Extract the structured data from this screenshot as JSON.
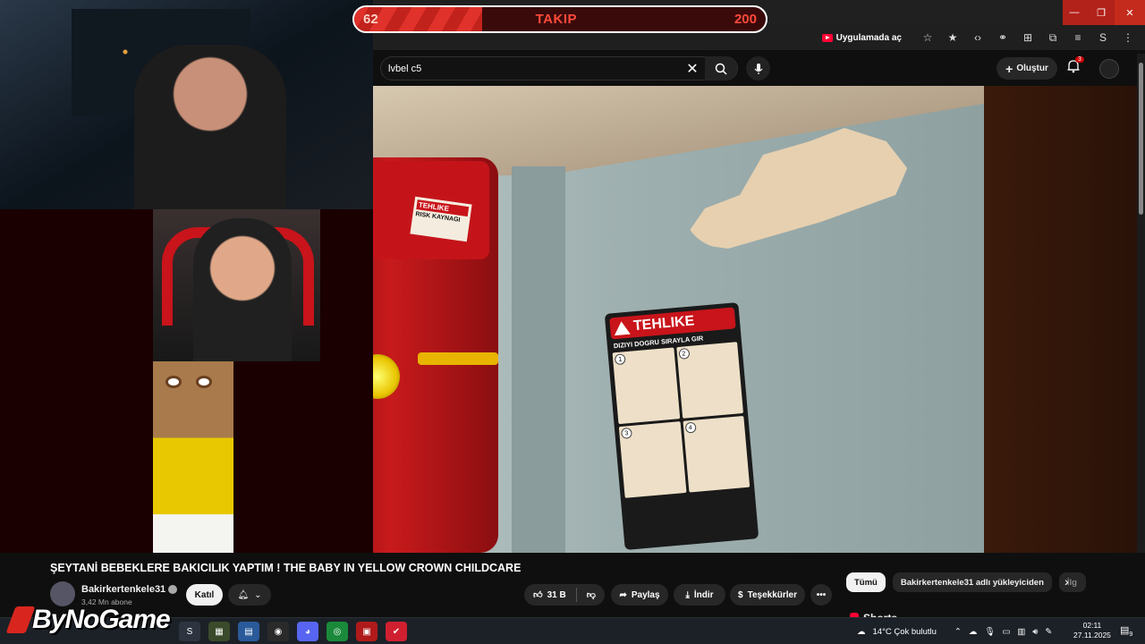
{
  "follow_goal": {
    "current": "62",
    "label": "TAKIP",
    "goal": "200",
    "progress": 0.31
  },
  "browser": {
    "open_in_app": "Uygulamada aç",
    "window_controls": {
      "minimize": "—",
      "maximize": "❐",
      "close": "✕"
    }
  },
  "youtube_header": {
    "search_value": "lvbel c5",
    "create_label": "Oluştur",
    "notification_count": "3"
  },
  "video_scene": {
    "sign_title": "TEHLIKE",
    "sign_subtitle": "DIZIYI DOGRU SIRAYLA GIR",
    "small_sign_title": "TEHLIKE",
    "small_sign_subtitle": "RISK KAYNAGI",
    "steps": [
      "1",
      "2",
      "3",
      "4"
    ]
  },
  "video_info": {
    "title": "ŞEYTANİ BEBEKLERE BAKICILIK YAPTIM ! THE BABY IN YELLOW CROWN CHILDCARE",
    "channel_name": "Bakirkertenkele31",
    "subscribers": "3,42 Mn abone",
    "join_label": "Katıl",
    "like_count": "31 B",
    "share_label": "Paylaş",
    "download_label": "İndir",
    "thanks_label": "Teşekkürler"
  },
  "sidebar_chips": [
    "Tümü",
    "Bakirkertenkele31 adlı yükleyiciden",
    "İlg"
  ],
  "shorts_heading": "Shorts",
  "taskbar": {
    "weather": "14°C  Çok bulutlu",
    "time": "02:11",
    "date": "27.11.2025",
    "notif_count": "9"
  },
  "overlay_logo": "ByNoGame",
  "colors": {
    "accent_red": "#ff0033",
    "bg": "#0f0f0f"
  }
}
